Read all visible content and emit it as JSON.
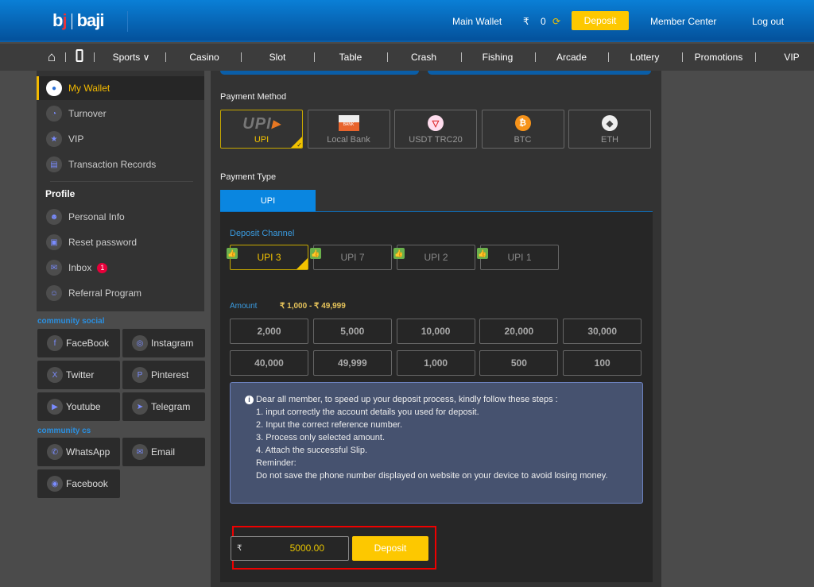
{
  "header": {
    "logo": "bj | baji",
    "main_wallet": "Main Wallet",
    "currency": "₹",
    "balance": "0",
    "deposit": "Deposit",
    "member_center": "Member Center",
    "logout": "Log out"
  },
  "nav": [
    {
      "label": "Sports ∨"
    },
    {
      "label": "Casino"
    },
    {
      "label": "Slot"
    },
    {
      "label": "Table"
    },
    {
      "label": "Crash"
    },
    {
      "label": "Fishing"
    },
    {
      "label": "Arcade"
    },
    {
      "label": "Lottery"
    },
    {
      "label": "Promotions"
    },
    {
      "label": "VIP"
    }
  ],
  "sidebar": {
    "wallet_items": [
      {
        "label": "My Wallet",
        "icon": "wallet-icon",
        "active": true
      },
      {
        "label": "Turnover",
        "icon": "turnover-icon"
      },
      {
        "label": "VIP",
        "icon": "vip-star-icon"
      },
      {
        "label": "Transaction Records",
        "icon": "records-icon"
      }
    ],
    "profile_title": "Profile",
    "profile_items": [
      {
        "label": "Personal Info",
        "icon": "user-icon"
      },
      {
        "label": "Reset password",
        "icon": "lock-icon"
      },
      {
        "label": "Inbox",
        "icon": "mail-icon",
        "badge": "1"
      },
      {
        "label": "Referral Program",
        "icon": "referral-icon"
      }
    ],
    "community_social_title": "community social",
    "social": [
      {
        "label": "FaceBook",
        "icon": "facebook-icon"
      },
      {
        "label": "Instagram",
        "icon": "instagram-icon"
      },
      {
        "label": "Twitter",
        "icon": "x-twitter-icon"
      },
      {
        "label": "Pinterest",
        "icon": "pinterest-icon"
      },
      {
        "label": "Youtube",
        "icon": "youtube-icon"
      },
      {
        "label": "Telegram",
        "icon": "telegram-icon"
      }
    ],
    "community_cs_title": "community cs",
    "cs": [
      {
        "label": "WhatsApp",
        "icon": "whatsapp-icon"
      },
      {
        "label": "Email",
        "icon": "email-icon"
      },
      {
        "label": "Facebook",
        "icon": "messenger-icon"
      }
    ]
  },
  "payment": {
    "method_title": "Payment Method",
    "methods": [
      {
        "label": "UPI",
        "icon": "upi-logo",
        "active": true
      },
      {
        "label": "Local Bank",
        "icon": "upi-bank-icon"
      },
      {
        "label": "USDT TRC20",
        "icon": "tron-icon"
      },
      {
        "label": "BTC",
        "icon": "bitcoin-icon"
      },
      {
        "label": "ETH",
        "icon": "ethereum-icon"
      }
    ],
    "type_title": "Payment Type",
    "type_tab": "UPI",
    "channel_title": "Deposit Channel",
    "channels": [
      {
        "label": "UPI 3",
        "active": true
      },
      {
        "label": "UPI 7"
      },
      {
        "label": "UPI 2"
      },
      {
        "label": "UPI 1"
      }
    ],
    "amount_title": "Amount",
    "amount_range": "₹ 1,000 - ₹ 49,999",
    "amounts": [
      "2,000",
      "5,000",
      "10,000",
      "20,000",
      "30,000",
      "40,000",
      "49,999",
      "1,000",
      "500",
      "100"
    ],
    "info_lines": [
      "Dear all member, to speed up your deposit process, kindly follow these steps :",
      "1. input correctly the account details you used for deposit.",
      "2. Input the correct reference number.",
      "3. Process only selected amount.",
      "4. Attach the successful Slip.",
      "Reminder:",
      "Do not save the phone number displayed on website on your device to avoid losing money."
    ],
    "input_currency": "₹",
    "input_value": "5000.00",
    "deposit_button": "Deposit"
  },
  "colors": {
    "accent": "#fdc800",
    "header": "#0a7fd6",
    "tab": "#0a86e0",
    "info_bg": "#46526f",
    "highlight": "#ee0000"
  }
}
